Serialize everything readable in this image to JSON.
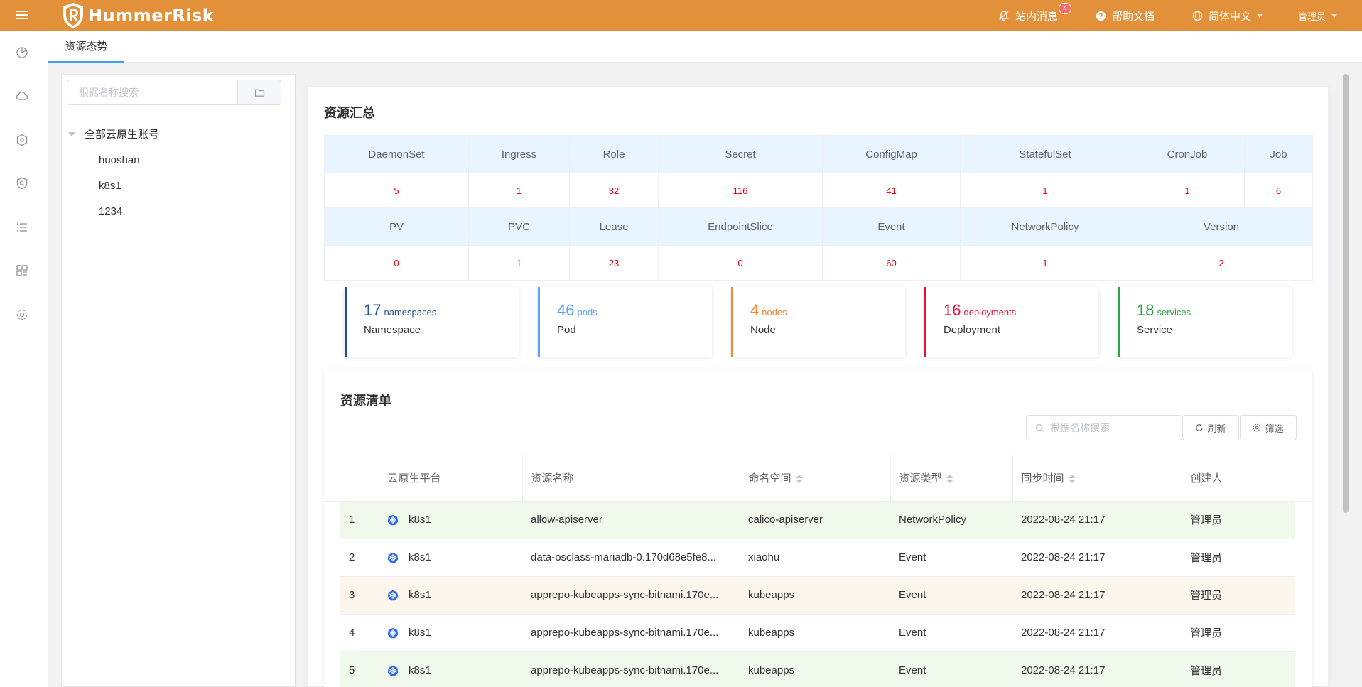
{
  "header": {
    "app_name": "HummerRisk",
    "messages_label": "站内消息",
    "messages_badge": "4",
    "help_label": "帮助文档",
    "language_label": "简体中文",
    "user_label": "管理员"
  },
  "sidebar": {
    "icons": [
      "dashboard-icon",
      "cloud-icon",
      "cluster-icon",
      "shield-search-icon",
      "list-icon",
      "apps-icon",
      "settings-icon"
    ]
  },
  "tabs": [
    {
      "label": "资源态势"
    }
  ],
  "tree": {
    "search_placeholder": "根据名称搜索",
    "root_label": "全部云原生账号",
    "children": [
      "huoshan",
      "k8s1",
      "1234"
    ]
  },
  "summary": {
    "title": "资源汇总",
    "row1_headers": [
      "DaemonSet",
      "Ingress",
      "Role",
      "Secret",
      "ConfigMap",
      "StatefulSet",
      "CronJob",
      "Job"
    ],
    "row1_values": [
      "5",
      "1",
      "32",
      "116",
      "41",
      "1",
      "1",
      "6"
    ],
    "row2_headers": [
      "PV",
      "PVC",
      "Lease",
      "EndpointSlice",
      "Event",
      "NetworkPolicy",
      "Version"
    ],
    "row2_values": [
      "0",
      "1",
      "23",
      "0",
      "60",
      "1",
      "2"
    ]
  },
  "stats": [
    {
      "num": "17",
      "unit": "namespaces",
      "label": "Namespace",
      "color": "#1d4f9f"
    },
    {
      "num": "46",
      "unit": "pods",
      "label": "Pod",
      "color": "#5aa0f5"
    },
    {
      "num": "4",
      "unit": "nodes",
      "label": "Node",
      "color": "#f0883a"
    },
    {
      "num": "16",
      "unit": "deployments",
      "label": "Deployment",
      "color": "#e0123a"
    },
    {
      "num": "18",
      "unit": "services",
      "label": "Service",
      "color": "#2aa540"
    }
  ],
  "resources": {
    "title": "资源清单",
    "search_placeholder": "根据名称搜索",
    "refresh_label": "刷新",
    "filter_label": "筛选",
    "columns": [
      "",
      "云原生平台",
      "资源名称",
      "命名空间",
      "资源类型",
      "同步时间",
      "创建人"
    ],
    "rows": [
      {
        "idx": "1",
        "platform": "k8s1",
        "name": "allow-apiserver",
        "namespace": "calico-apiserver",
        "type": "NetworkPolicy",
        "time": "2022-08-24 21:17",
        "creator": "管理员",
        "bg": "#f0f9eb"
      },
      {
        "idx": "2",
        "platform": "k8s1",
        "name": "data-osclass-mariadb-0.170d68e5fe8...",
        "namespace": "xiaohu",
        "type": "Event",
        "time": "2022-08-24 21:17",
        "creator": "管理员",
        "bg": "#ffffff"
      },
      {
        "idx": "3",
        "platform": "k8s1",
        "name": "apprepo-kubeapps-sync-bitnami.170e...",
        "namespace": "kubeapps",
        "type": "Event",
        "time": "2022-08-24 21:17",
        "creator": "管理员",
        "bg": "#fdf6ec"
      },
      {
        "idx": "4",
        "platform": "k8s1",
        "name": "apprepo-kubeapps-sync-bitnami.170e...",
        "namespace": "kubeapps",
        "type": "Event",
        "time": "2022-08-24 21:17",
        "creator": "管理员",
        "bg": "#ffffff"
      },
      {
        "idx": "5",
        "platform": "k8s1",
        "name": "apprepo-kubeapps-sync-bitnami.170e...",
        "namespace": "kubeapps",
        "type": "Event",
        "time": "2022-08-24 21:17",
        "creator": "管理员",
        "bg": "#f0f9eb"
      }
    ]
  }
}
